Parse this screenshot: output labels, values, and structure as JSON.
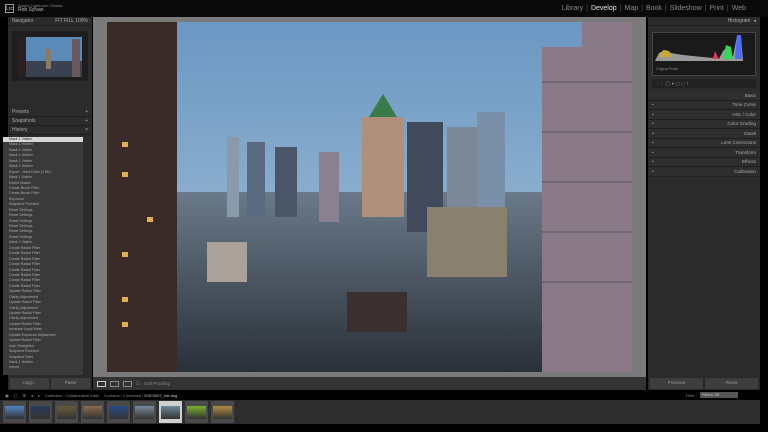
{
  "app": {
    "logo": "Lrc",
    "product": "Adobe Lightroom Classic",
    "user": "Rob Sylvan"
  },
  "modules": [
    {
      "label": "Library"
    },
    {
      "label": "Develop",
      "active": true
    },
    {
      "label": "Map"
    },
    {
      "label": "Book"
    },
    {
      "label": "Slideshow"
    },
    {
      "label": "Print"
    },
    {
      "label": "Web"
    }
  ],
  "left": {
    "navigator": {
      "title": "Navigator",
      "zoom_options": [
        "FIT",
        "FILL",
        "100%"
      ]
    },
    "presets": "Presets",
    "snapshots": "Snapshots",
    "history": "History",
    "history_items": [
      "Mask 1 Visible",
      "Mask 1 Hidden",
      "Mask 1 Visible",
      "Mask 1 Hidden",
      "Mask 1 Visible",
      "Mask 1 Hidden",
      "Export - Hard Drive (1 file)",
      "Mask 1 Visible",
      "Delete Masks",
      "Create Brush Filter",
      "Create Brush Filter",
      "Exposure",
      "Snapshot Finished",
      "Reset Settings",
      "Reset Settings",
      "Reset Settings",
      "Reset Settings",
      "Reset Settings",
      "Reset Settings",
      "Mask 1 Visible",
      "Create Radial Filter",
      "Create Radial Filter",
      "Create Radial Filter",
      "Create Radial Filter",
      "Create Radial Filter",
      "Create Radial Filter",
      "Create Radial Filter",
      "Create Radial Filter",
      "Update Radial Filter",
      "Clarity Adjustment",
      "Update Radial Filter",
      "Clarity Adjustment",
      "Update Radial Filter",
      "Clarity Adjustment",
      "Update Radial Filter",
      "Increase Local Mask",
      "Update Exposure Adjustment",
      "Update Radial Filter",
      "Auto Straighten",
      "Snapshot Finished",
      "Snapshot Start",
      "Mask 1 Hidden",
      "Import"
    ],
    "copy": "Copy...",
    "paste": "Paste"
  },
  "toolbar": {
    "soft_proofing": "Soft Proofing"
  },
  "right": {
    "histogram": {
      "title": "Histogram",
      "original_photo": "Original Photo",
      "colors": [
        "#c9a93a",
        "#e0365a",
        "#34d65a",
        "#4a6cff"
      ]
    },
    "panels": [
      "Basic",
      "Tone Curve",
      "HSL / Color",
      "Color Grading",
      "Detail",
      "Lens Corrections",
      "Transform",
      "Effects",
      "Calibration"
    ],
    "previous": "Previous",
    "reset": "Reset"
  },
  "filmstrip": {
    "source": "Collection : Collaborative Edits",
    "count": "9 photos / 1 selected /",
    "filename": "DSC0007_hdr.dng",
    "filter_label": "Filter :",
    "filter_value": "Filters Off",
    "thumbs": [
      "#4f86c6",
      "#2a3a5a",
      "#6a5a3a",
      "#8a6a4a",
      "#2a4a8a",
      "#7a8aa0",
      "#6a8a9a",
      "#7ab030",
      "#b08a40"
    ],
    "selected_index": 6
  }
}
